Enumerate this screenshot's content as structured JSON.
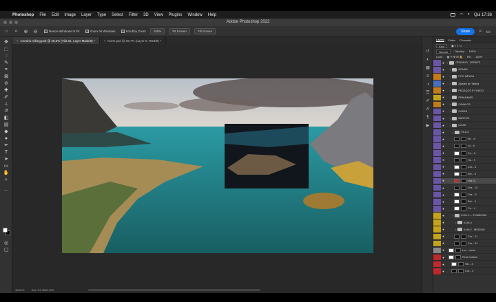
{
  "menubar": {
    "app": "Photoshop",
    "items": [
      "File",
      "Edit",
      "Image",
      "Layer",
      "Type",
      "Select",
      "Filter",
      "3D",
      "View",
      "Plugins",
      "Window",
      "Help"
    ],
    "clock": "Qui 17:36"
  },
  "window": {
    "title": "Adobe Photoshop 2022"
  },
  "options": {
    "check_resize_windows": "Resize Windows to Fit",
    "check_zoom_all": "Zoom All Windows",
    "check_scrubby": "Scrubby Zoom",
    "btn_100": "100%",
    "btn_fit": "Fit Screen",
    "btn_fill": "Fill Screen",
    "share": "Share"
  },
  "tabs": [
    {
      "label": "Cenário Viking.psd @ 46,5% (Vila 01, Layer Mask/8) *"
    },
    {
      "label": "Norte.psd @ 66,7% (Layer 0, RGB/8) *"
    }
  ],
  "status": {
    "zoom": "46,51%",
    "doc": "Doc: 31,7M/2,72G"
  },
  "layers_panel": {
    "tabs": [
      "Layers",
      "Paths",
      "Channels"
    ],
    "kind_label": "Kind",
    "blend_mode": "Normal",
    "opacity_label": "Opacity:",
    "opacity_value": "100%",
    "lock_label": "Lock:",
    "fill_label": "Fill:",
    "fill_value": "100%",
    "rows": [
      {
        "name": "CENÁRIO - FRENTE",
        "color": "#6b55a8",
        "type": "folder",
        "indent": 0
      },
      {
        "name": "ÁGUAS",
        "color": "#6b55a8",
        "type": "folder",
        "indent": 1
      },
      {
        "name": "FX E NÉVOA",
        "color": "#c47a1a",
        "type": "folder",
        "indent": 1
      },
      {
        "name": "Ajustes de Tabela",
        "color": "#4a6fc0",
        "type": "folder",
        "indent": 1
      },
      {
        "name": "PEDAÇOS E FUNDO",
        "color": "#c47a1a",
        "type": "folder",
        "indent": 1
      },
      {
        "name": "PRAÍA/MAR",
        "color": "#c4a21a",
        "type": "folder",
        "indent": 1
      },
      {
        "name": "CAVALOS",
        "color": "#c47a1a",
        "type": "folder",
        "indent": 1
      },
      {
        "name": "CASAS",
        "color": "#6b55a8",
        "type": "folder",
        "indent": 1
      },
      {
        "name": "BARCOS",
        "color": "#6b55a8",
        "type": "folder",
        "indent": 1
      },
      {
        "name": "ILHAS",
        "color": "#6b55a8",
        "type": "folder",
        "indent": 1
      },
      {
        "name": "VILA 6",
        "color": "#6b55a8",
        "type": "folder",
        "indent": 2
      },
      {
        "name": "rel... 6",
        "color": "#6b55a8",
        "type": "layer",
        "thumb": "dark",
        "indent": 3
      },
      {
        "name": "vil... 6",
        "color": "#6b55a8",
        "type": "layer",
        "thumb": "dark",
        "indent": 3
      },
      {
        "name": "Cu... 6",
        "color": "#6b55a8",
        "type": "layer",
        "thumb": "white",
        "indent": 3
      },
      {
        "name": "Hu... 5",
        "color": "#6b55a8",
        "type": "layer",
        "thumb": "dark",
        "indent": 3
      },
      {
        "name": "Col... 5",
        "color": "#6b55a8",
        "type": "layer",
        "thumb": "white",
        "indent": 3
      },
      {
        "name": "Sel... 5",
        "color": "#6b55a8",
        "type": "layer",
        "thumb": "white",
        "indent": 3
      },
      {
        "name": "Vila 01",
        "color": "#6b55a8",
        "type": "layer",
        "thumb": "red",
        "indent": 3,
        "selected": true
      },
      {
        "name": "Gra... 01",
        "color": "#6b55a8",
        "type": "layer",
        "thumb": "dark",
        "indent": 3
      },
      {
        "name": "Gra... 5",
        "color": "#6b55a8",
        "type": "layer",
        "thumb": "white",
        "indent": 3
      },
      {
        "name": "Sel... 3",
        "color": "#6b55a8",
        "type": "layer",
        "thumb": "white",
        "indent": 3
      },
      {
        "name": "Cu... 4",
        "color": "#6b55a8",
        "type": "layer",
        "thumb": "white",
        "indent": 3
      },
      {
        "name": "ILHA 2 — FUNDO/NA",
        "color": "#c4a21a",
        "type": "folder",
        "indent": 2
      },
      {
        "name": "ILHA 3",
        "color": "#c4a21a",
        "type": "folder",
        "indent": 3
      },
      {
        "name": "ILHA 2 - MEDIUM",
        "color": "#c4a21a",
        "type": "folder",
        "indent": 3
      },
      {
        "name": "Cur... 21",
        "color": "#c4a21a",
        "type": "layer",
        "thumb": "dark",
        "indent": 3
      },
      {
        "name": "Cur... 24",
        "color": "#c4a21a",
        "type": "layer",
        "thumb": "dark",
        "indent": 3
      },
      {
        "name": "Lev... curve",
        "color": "#888888",
        "type": "layer",
        "thumb": "white",
        "indent": 1
      },
      {
        "name": "Pinch bottom",
        "color": "#c0282a",
        "type": "layer",
        "thumb": "white",
        "indent": 1
      },
      {
        "name": "Vib... 4",
        "color": "#c0282a",
        "type": "layer",
        "thumb": "white",
        "indent": 2
      },
      {
        "name": "Cur... 4",
        "color": "#c0282a",
        "type": "layer",
        "thumb": "dark",
        "indent": 2
      }
    ]
  }
}
